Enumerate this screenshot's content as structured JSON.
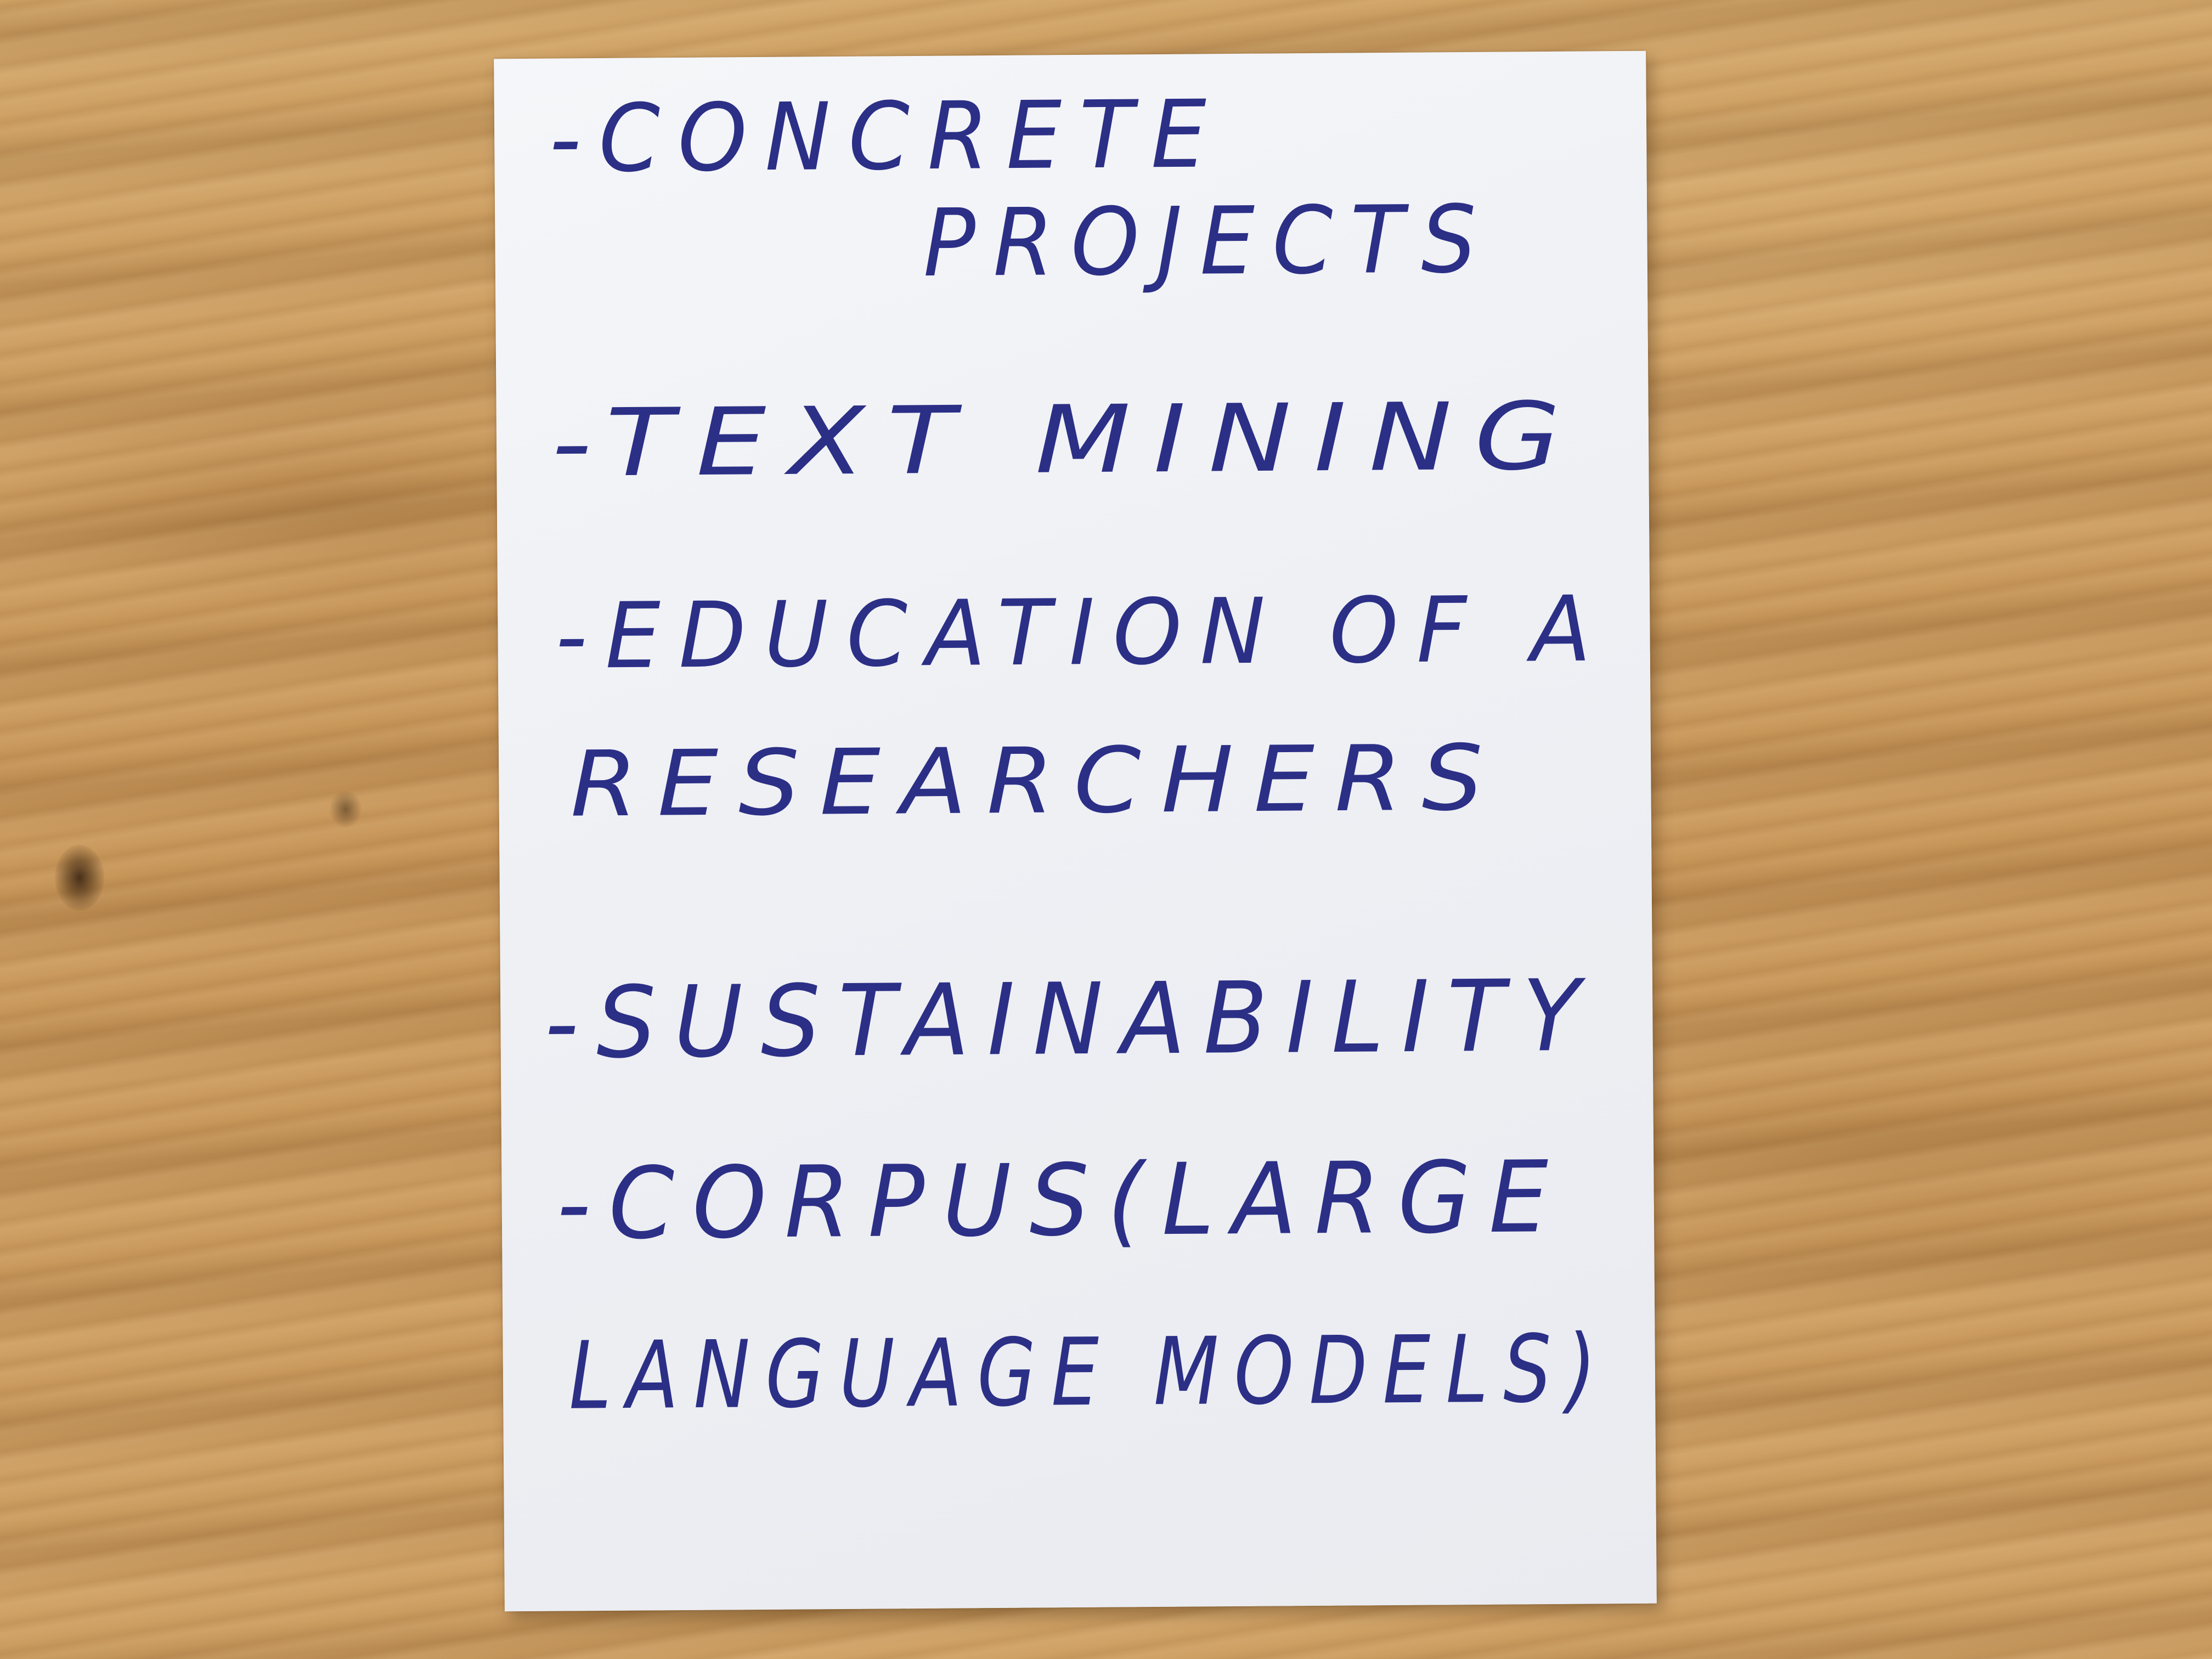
{
  "note": {
    "lines": [
      "-CONCRETE",
      "PROJECTS",
      "-TEXT MINING",
      "-EDUCATION OF A",
      "RESEARCHERS",
      "-SUSTAINABILITY",
      "-CORPUS(LARGE",
      "LANGUAGE MODELS)"
    ]
  },
  "colors": {
    "ink": "#2c2f86",
    "card": "#f1f2f6",
    "table": "#c99a5e"
  }
}
